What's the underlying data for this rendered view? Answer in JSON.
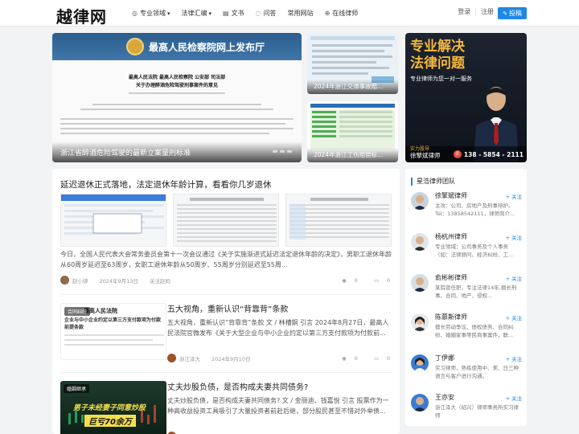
{
  "header": {
    "logo": "越律网",
    "nav": [
      {
        "icon": "compass-icon",
        "label": "专业领域",
        "caret": "▾"
      },
      {
        "icon": "",
        "label": "法律汇编",
        "caret": "▾"
      },
      {
        "icon": "document-icon",
        "label": "文书",
        "caret": ""
      },
      {
        "icon": "chat-icon",
        "label": "问答",
        "caret": ""
      },
      {
        "icon": "",
        "label": "常用网站",
        "caret": ""
      },
      {
        "icon": "globe-icon",
        "label": "在线律师",
        "caret": ""
      }
    ],
    "login": "登录",
    "separator": "|",
    "register": "注册",
    "post_button": "投稿"
  },
  "banner_main": {
    "header_text": "最高人民检察院网上发布厅",
    "doc_heading_1": "最高人民法院 最高人民检察院 公安部 司法部",
    "doc_heading_2": "关于办理醉酒危险驾驶刑事案件的意见",
    "caption": "浙江省醉酒危险驾驶的最新立案量刑标准"
  },
  "small_banners": [
    {
      "caption": "2024年浙江交通事故赔..."
    },
    {
      "caption": "2024年浙江工伤赔偿标..."
    }
  ],
  "ad": {
    "title_line1": "专业解决",
    "title_line2": "法律问题",
    "subtitle": "专业律师为您一对一服务",
    "tag": "实力股导",
    "name": "徐擎斌律师",
    "phone": "138 - 5854 - 2111"
  },
  "posts": [
    {
      "title": "延迟退休正式落地，法定退休年龄计算，看看你几岁退休",
      "excerpt": "今日，全国人民代表大会常务委员会第十一次会议通过《关于实施渐进式延迟法定退休年龄的决定》，男职工退休年龄从60周岁延迟至63周岁，女职工退休年龄从50周岁、55周岁分别延迟至55周...",
      "author": "赵小律",
      "date": "2024年9月13日",
      "extra": "关注赵妈",
      "views": "0",
      "comments": "0",
      "likes": "0"
    },
    {
      "tag": "合同纠纷",
      "title": "五大视角，重新认识“背靠背”条款",
      "excerpt": "五大视角，重新认识“背靠背”条款 文 / 林槽銅 引言 2024年8月27日，最高人民法院官微发布《关于大型企业与中小企业约定以第三方支付款项为付款前...",
      "author": "浙江泽大",
      "date": "2024年9月10日",
      "views": "0",
      "comments": "0",
      "likes": "0",
      "thumb_heading": "最高人民法院",
      "thumb_sub": "企业与中小企业约定以第三方支付款项为付款前提条款"
    },
    {
      "tag": "婚姻继承",
      "title": "丈夫炒股负债，是否构成夫妻共同债务?",
      "excerpt": "丈夫炒股负债，是否构成夫妻共同债务? 文 / 金丽迪、钱嘉悦 引言 股票作为一种高收益投资工具吸引了大量投资者前赴后继，部分股民甚至不惜对外举债...",
      "thumb_line1": "男子未经妻子同意炒股",
      "thumb_line2": "巨亏70余万"
    }
  ],
  "sidebar": {
    "title": "星浩律师团队",
    "follow_label": "+ 关注",
    "lawyers": [
      {
        "name": "徐擎斌律师",
        "bio": "主攻：公司、房地产及刑事辩护。Tel：13858542111，律师简介..."
      },
      {
        "name": "杨杭州律师",
        "bio": "专业领域：公司事务及个人事务（如：法律顾问、经济纠纷、工..."
      },
      {
        "name": "俞彬彬律师",
        "bio": "某院曾任职，专注法律14年,擅长刑事、合同、地产、侵权..."
      },
      {
        "name": "陈慕斯律师",
        "bio": "擅长劳动争议、债权债务、合同纠纷、婚姻家事等民商事案件，联..."
      },
      {
        "name": "丁伊娜",
        "bio": "实习律师，熟练使用中、美、日三种语言与客户进行沟通。"
      },
      {
        "name": "王亦安",
        "bio": "浙江泽大（绍兴）律师事务所实习律师"
      }
    ]
  },
  "colors": {
    "accent": "#1e88e5",
    "ad_gold": "#f5b83a"
  }
}
